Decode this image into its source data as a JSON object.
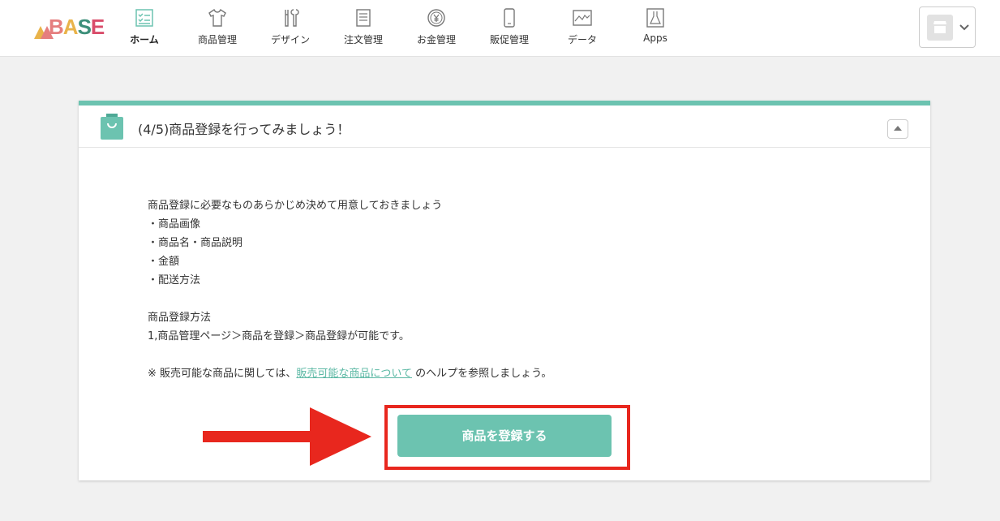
{
  "header": {
    "logo_text": "BASE",
    "nav": [
      {
        "label": "ホーム",
        "icon": "checklist-icon",
        "active": true
      },
      {
        "label": "商品管理",
        "icon": "tshirt-icon",
        "active": false
      },
      {
        "label": "デザイン",
        "icon": "tools-icon",
        "active": false
      },
      {
        "label": "注文管理",
        "icon": "document-icon",
        "active": false
      },
      {
        "label": "お金管理",
        "icon": "yen-coin-icon",
        "active": false
      },
      {
        "label": "販促管理",
        "icon": "smartphone-icon",
        "active": false
      },
      {
        "label": "データ",
        "icon": "line-chart-icon",
        "active": false
      },
      {
        "label": "Apps",
        "icon": "flask-icon",
        "active": false
      }
    ],
    "shop_switcher_icon": "shop-icon"
  },
  "card": {
    "title": "(4/5)商品登録を行ってみましょう！",
    "intro": "商品登録に必要なものあらかじめ決めて用意しておきましょう",
    "items": [
      "・商品画像",
      "・商品名・商品説明",
      "・金額",
      "・配送方法"
    ],
    "method_heading": "商品登録方法",
    "method_text": "1,商品管理ページ＞商品を登録＞商品登録が可能です。",
    "note_prefix": "※ 販売可能な商品に関しては、",
    "note_link": "販売可能な商品について",
    "note_suffix": " のヘルプを参照しましょう。",
    "register_button": "商品を登録する"
  },
  "colors": {
    "accent": "#6cc3b0",
    "link": "#5bb8a4",
    "highlight": "#e8271e",
    "background": "#f1f1f1"
  }
}
